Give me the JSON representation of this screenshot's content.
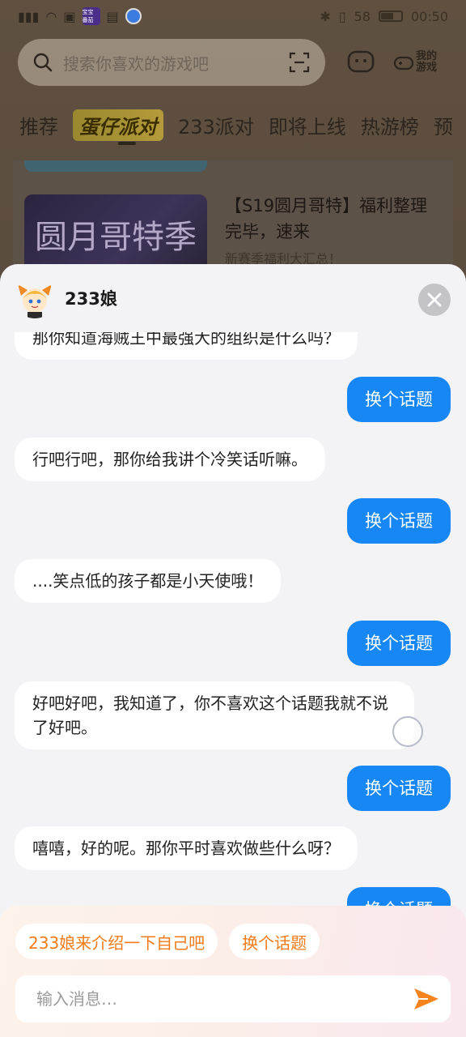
{
  "status_bar": {
    "app_badge": "宝宝\n番茄",
    "battery": "58",
    "time": "00:50"
  },
  "search": {
    "placeholder": "搜索你喜欢的游戏吧",
    "my_games_label": "我的游戏"
  },
  "tabs": [
    {
      "label": "推荐"
    },
    {
      "label": "蛋仔派对"
    },
    {
      "label": "233派对"
    },
    {
      "label": "即将上线"
    },
    {
      "label": "热游榜"
    },
    {
      "label": "预"
    }
  ],
  "feed_card": {
    "thumb_text": "圆月哥特季",
    "title": "【S19圆月哥特】福利整理完毕，速来",
    "subtitle": "新赛季福利大汇总！"
  },
  "chat": {
    "title": "233娘",
    "messages": [
      {
        "role": "bot",
        "text": "那你知道海贼王中最强大的组织是什么吗？"
      },
      {
        "role": "user",
        "text": "换个话题"
      },
      {
        "role": "bot",
        "text": "行吧行吧，那你给我讲个冷笑话听嘛。"
      },
      {
        "role": "user",
        "text": "换个话题"
      },
      {
        "role": "bot",
        "text": "....笑点低的孩子都是小天使哦！"
      },
      {
        "role": "user",
        "text": "换个话题"
      },
      {
        "role": "bot",
        "text": "好吧好吧，我知道了，你不喜欢这个话题我就不说了好吧。"
      },
      {
        "role": "user",
        "text": "换个话题"
      },
      {
        "role": "bot",
        "text": "嘻嘻，好的呢。那你平时喜欢做些什么呀？"
      },
      {
        "role": "user",
        "text": "换个话题"
      }
    ],
    "suggestions": [
      "233娘来介绍一下自己吧",
      "换个话题"
    ],
    "input_placeholder": "输入消息…"
  },
  "colors": {
    "user_bubble": "#1787f6",
    "chip_text": "#f07b1a",
    "send_icon": "#f5841f"
  }
}
